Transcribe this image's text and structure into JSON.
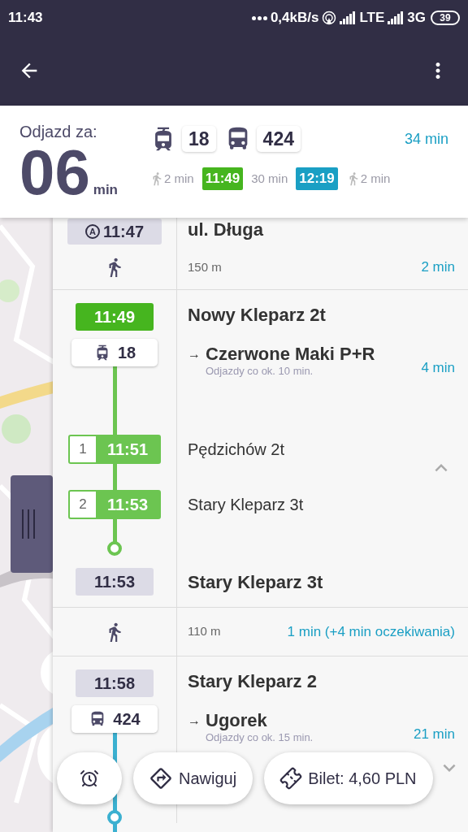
{
  "status_bar": {
    "time": "11:43",
    "network_speed": "0,4kB/s",
    "network_1": "LTE",
    "network_2": "3G",
    "battery": "39"
  },
  "header": {
    "departure_label": "Odjazd za:",
    "minutes": "06",
    "minutes_unit": "min",
    "total": "34 min",
    "lines": [
      {
        "kind": "tram",
        "number": "18"
      },
      {
        "kind": "bus",
        "number": "424"
      }
    ],
    "timeline": [
      {
        "kind": "walk",
        "text": "2 min"
      },
      {
        "kind": "time",
        "text": "11:49",
        "color": "#46b51f"
      },
      {
        "kind": "gap",
        "text": "30 min"
      },
      {
        "kind": "time",
        "text": "12:19",
        "color": "#1a9fc4"
      },
      {
        "kind": "walk",
        "text": "2 min"
      }
    ]
  },
  "steps": [
    {
      "kind": "stop",
      "marker": "A",
      "time": "11:47",
      "name": "ul. Długa"
    },
    {
      "kind": "walk",
      "distance": "150 m",
      "duration": "2 min"
    },
    {
      "kind": "ride",
      "line": {
        "kind": "tram",
        "number": "18"
      },
      "color": "#6cc551",
      "departure": {
        "time": "11:49",
        "color": "#46b51f"
      },
      "from": "Nowy Kleparz 2t",
      "arrow": "→",
      "direction": "Czerwone Maki P+R",
      "frequency": "Odjazdy co ok. 10 min.",
      "duration": "4 min",
      "expanded": true,
      "stops": [
        {
          "number": "1",
          "time": "11:51",
          "name": "Pędzichów 2t"
        },
        {
          "number": "2",
          "time": "11:53",
          "name": "Stary Kleparz 3t"
        }
      ],
      "arrival_time": "11:53",
      "to": "Stary Kleparz 3t"
    },
    {
      "kind": "walk",
      "distance": "110 m",
      "duration": "1 min (+4 min oczekiwania)"
    },
    {
      "kind": "ride",
      "line": {
        "kind": "bus",
        "number": "424"
      },
      "color": "#3bb0d0",
      "departure": {
        "time": "11:58",
        "color": "#dcdbe6"
      },
      "from": "Stary Kleparz 2",
      "arrow": "→",
      "direction": "Ugorek",
      "frequency": "Odjazdy co ok. 15 min.",
      "duration": "21 min",
      "expanded": false
    }
  ],
  "actions": [
    {
      "kind": "alarm"
    },
    {
      "kind": "navigate",
      "label": "Nawiguj"
    },
    {
      "kind": "ticket",
      "label": "Bilet: 4,60 PLN"
    }
  ]
}
